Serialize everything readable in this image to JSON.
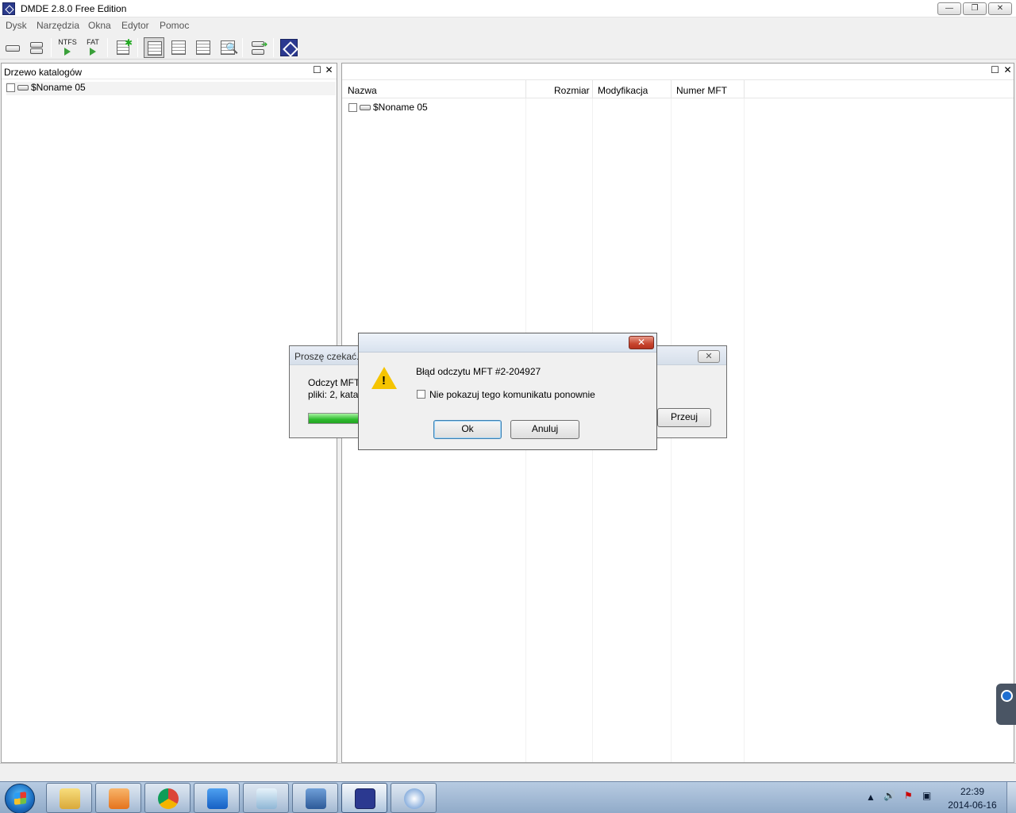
{
  "window": {
    "title": "DMDE 2.8.0 Free Edition",
    "buttons": {
      "minimize": "—",
      "restore": "❐",
      "close": "✕"
    }
  },
  "menu": [
    "Dysk",
    "Narzędzia",
    "Okna",
    "Edytor",
    "Pomoc"
  ],
  "toolbar": {
    "ntfs_label": "NTFS",
    "fat_label": "FAT",
    "icons": [
      "drive-icon",
      "drives-icon",
      "ntfs-scan-icon",
      "fat-scan-icon",
      "new-file-icon",
      "tree-view-icon",
      "list-view-icon",
      "details-view-icon",
      "search-view-icon",
      "recover-icon",
      "dmde-logo-icon"
    ]
  },
  "left_pane": {
    "title": "Drzewo katalogów",
    "items": [
      {
        "label": "$Noname 05"
      }
    ]
  },
  "right_pane": {
    "columns": [
      "Nazwa",
      "Rozmiar",
      "Modyfikacja",
      "Numer MFT"
    ],
    "rows": [
      {
        "name": "$Noname 05"
      }
    ]
  },
  "progress_dialog": {
    "title": "Proszę czekać...",
    "line1": "Odczyt MFT",
    "line2": "pliki: 2, kata",
    "button_label": "Przeuj",
    "progress_percent": 100
  },
  "error_dialog": {
    "message": "Błąd odczytu MFT #2-204927",
    "checkbox_label": "Nie pokazuj tego komunikatu ponownie",
    "ok_label": "Ok",
    "cancel_label": "Anuluj"
  },
  "taskbar": {
    "apps": [
      "explorer-icon",
      "media-player-icon",
      "chrome-icon",
      "teamviewer-icon",
      "notes-icon",
      "network-icon",
      "dmde-icon",
      "update-icon"
    ],
    "time": "22:39",
    "date": "2014-06-16"
  },
  "colors": {
    "progress": "#2fbc2f",
    "warning": "#f5c400",
    "close_red": "#c7452e",
    "taskbar": "#91abc9"
  }
}
